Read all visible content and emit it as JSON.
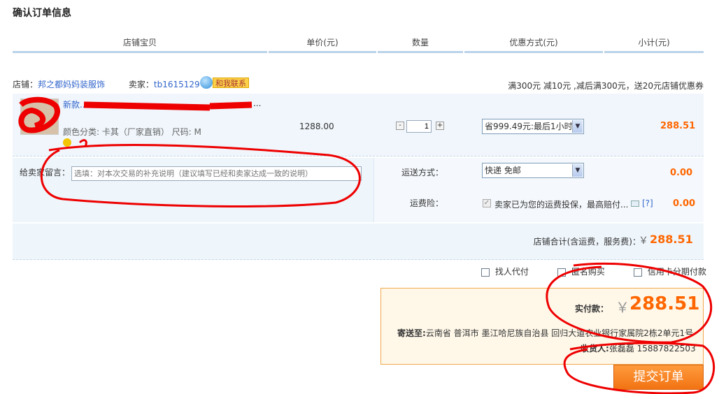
{
  "page_title": "确认订单信息",
  "columns": {
    "item": "店铺宝贝",
    "price": "单价(元)",
    "qty": "数量",
    "discount": "优惠方式(元)",
    "subtotal": "小计(元)"
  },
  "shop": {
    "shop_label": "店铺：",
    "shop_name": "邦之都妈妈装服饰",
    "seller_label": "卖家：",
    "seller_id": "tb1615129",
    "contact_label": "和我联系",
    "promo": "满300元 减10元 ,减后满300元，送20元店铺优惠券"
  },
  "item": {
    "title": "新款...",
    "title_tail": "...",
    "attrs": "颜色分类: 卡其（厂家直销）  尺码: M",
    "price": "1288.00",
    "qty_minus": "-",
    "qty": "1",
    "qty_plus": "+",
    "discount_option": "省999.49元:最后1小时",
    "subtotal": "288.51"
  },
  "message": {
    "label": "给卖家留言：",
    "placeholder": "选填：对本次交易的补充说明（建议填写已经和卖家达成一致的说明）"
  },
  "shipping": {
    "label": "运送方式：",
    "option": "快递 免邮",
    "fee": "0.00"
  },
  "insurance": {
    "label": "运费险：",
    "text": "卖家已为您的运费投保，最高赔付...",
    "help": "[?]",
    "fee": "0.00"
  },
  "shop_total": {
    "label": "店铺合计(含运费，服务费)：",
    "currency": "￥",
    "amount": "288.51"
  },
  "options": {
    "proxy_pay": "找人代付",
    "anonymous": "匿名购买",
    "installment": "信用卡分期付款"
  },
  "summary": {
    "paid_label": "实付款：",
    "currency": "￥",
    "paid_amount": "288.51",
    "ship_to_label": "寄送至:",
    "address": "云南省 普洱市 墨江哈尼族自治县 回归大道农业银行家属院2栋2单元1号",
    "receiver_label": "收货人:",
    "receiver": "张磊磊 15887822503"
  },
  "submit_label": "提交订单"
}
